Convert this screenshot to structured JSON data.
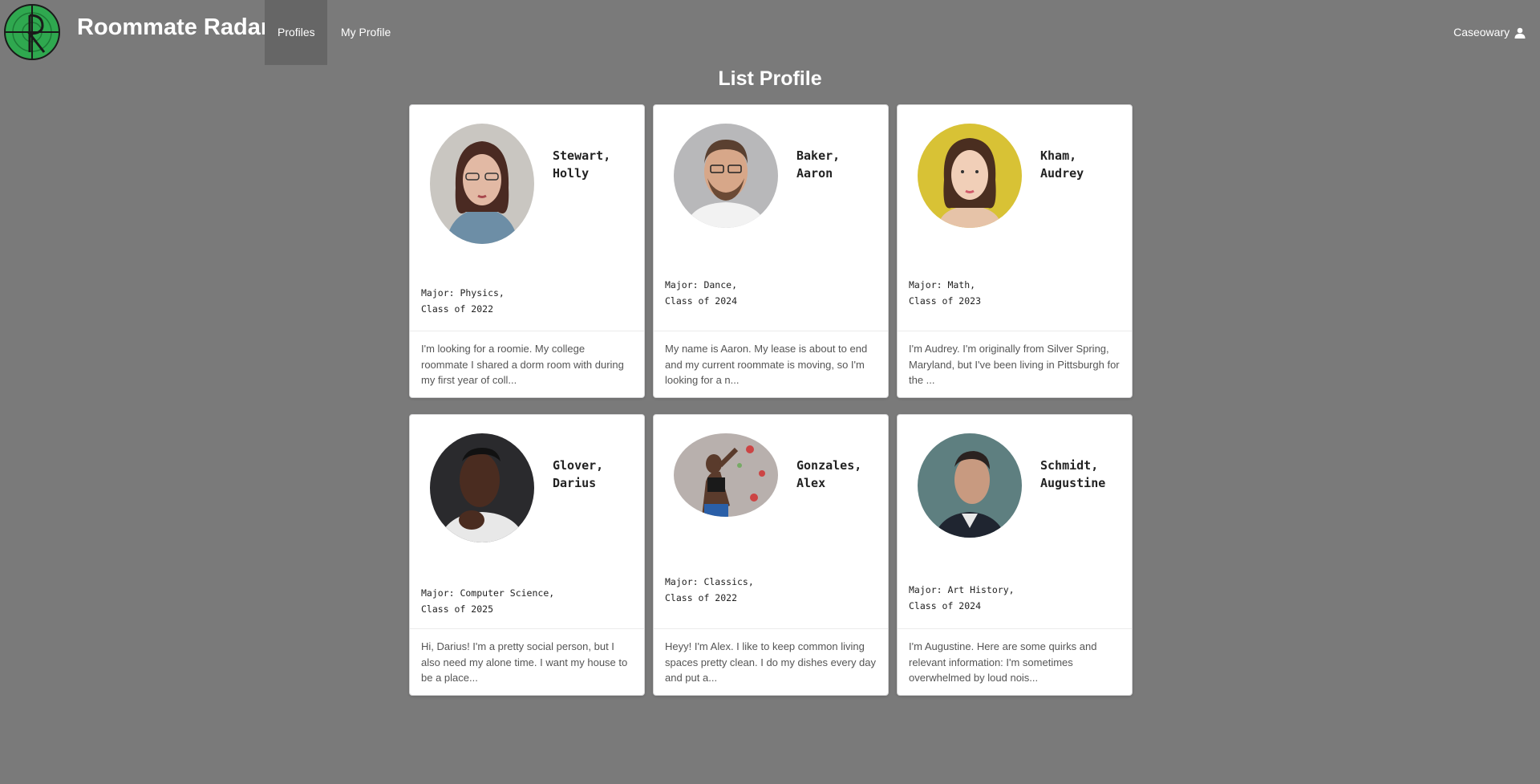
{
  "app": {
    "brand": "Roommate Radar",
    "nav": [
      {
        "label": "Profiles",
        "active": true
      },
      {
        "label": "My Profile",
        "active": false
      }
    ],
    "user": "Caseowary",
    "page_title": "List Profile"
  },
  "profiles": [
    {
      "name_line1": "Stewart,",
      "name_line2": "Holly",
      "major": "Major: Physics,",
      "class": "Class of 2022",
      "description": "I'm looking for a roomie. My college roommate I shared a dorm room with during my first year of coll...",
      "avatar_icon": "person-photo"
    },
    {
      "name_line1": "Baker,",
      "name_line2": "Aaron",
      "major": "Major: Dance,",
      "class": "Class of 2024",
      "description": "My name is Aaron. My lease is about to end and my current roommate is moving, so I'm looking for a n...",
      "avatar_icon": "person-photo"
    },
    {
      "name_line1": "Kham,",
      "name_line2": "Audrey",
      "major": "Major: Math,",
      "class": "Class of 2023",
      "description": "I'm Audrey. I'm originally from Silver Spring, Maryland, but I've been living in Pittsburgh for the ...",
      "avatar_icon": "person-photo"
    },
    {
      "name_line1": "Glover,",
      "name_line2": "Darius",
      "major": "Major: Computer Science,",
      "class": "Class of 2025",
      "description": "Hi, Darius! I'm a pretty social person, but I also need my alone time. I want my house to be a place...",
      "avatar_icon": "person-photo"
    },
    {
      "name_line1": "Gonzales,",
      "name_line2": "Alex",
      "major": "Major: Classics,",
      "class": "Class of 2022",
      "description": "Heyy! I'm Alex. I like to keep common living spaces pretty clean. I do my dishes every day and put a...",
      "avatar_icon": "person-photo"
    },
    {
      "name_line1": "Schmidt,",
      "name_line2": "Augustine",
      "major": "Major: Art History,",
      "class": "Class of 2024",
      "description": "I'm Augustine. Here are some quirks and relevant information: I'm sometimes overwhelmed by loud nois...",
      "avatar_icon": "person-photo"
    }
  ],
  "colors": {
    "background": "#7a7a7a",
    "nav_active": "#666666",
    "logo_green": "#2fa84f"
  }
}
